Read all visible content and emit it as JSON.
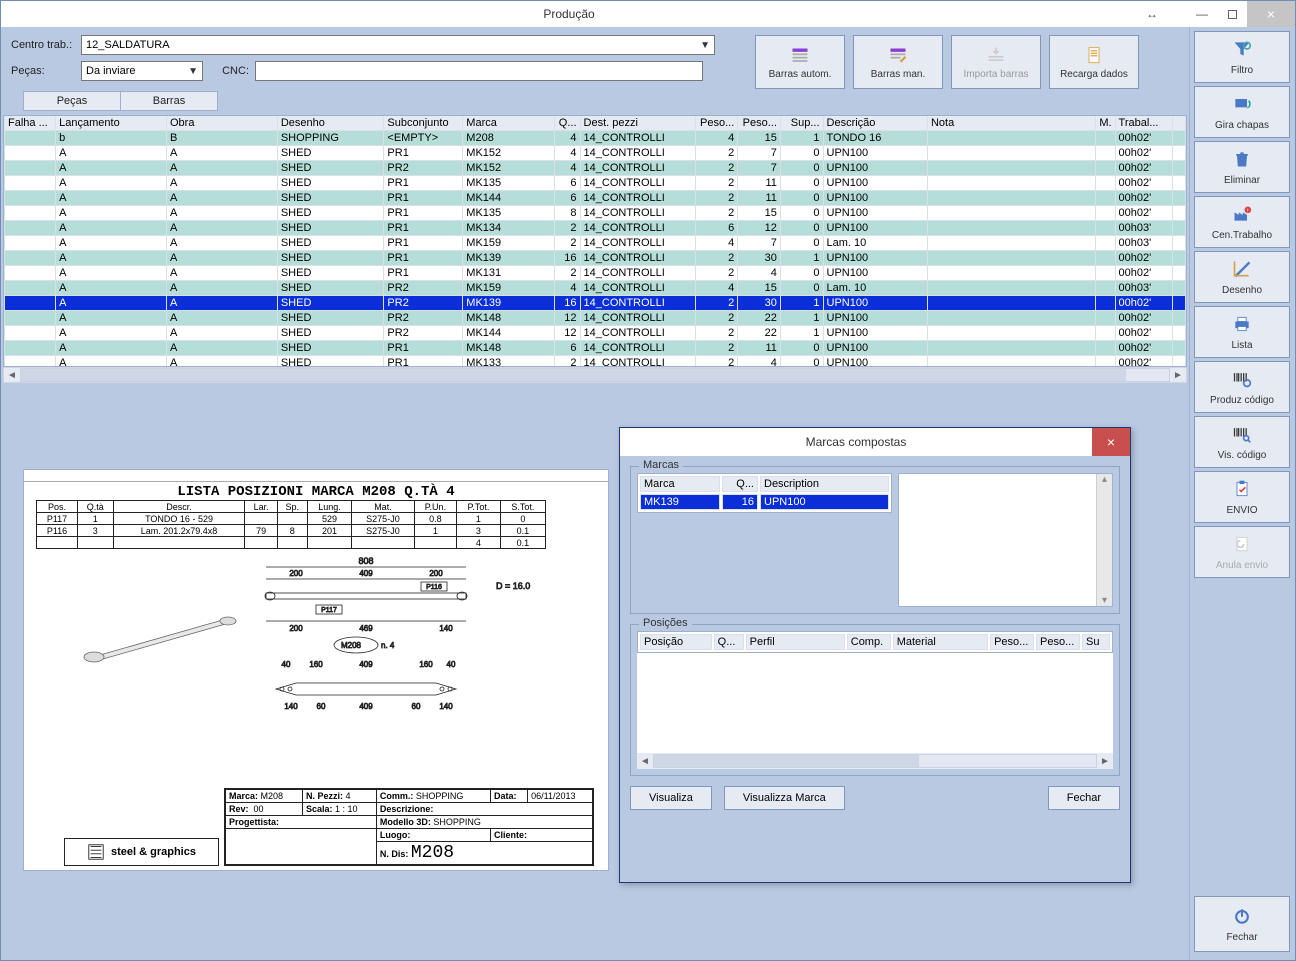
{
  "window": {
    "title": "Produção"
  },
  "form": {
    "centro_label": "Centro trab.:",
    "centro_value": "12_SALDATURA",
    "pecas_label": "Peças:",
    "pecas_value": "Da inviare",
    "cnc_label": "CNC:"
  },
  "toolbar": {
    "barras_autom": "Barras autom.",
    "barras_man": "Barras man.",
    "importa_barras": "Importa barras",
    "recarga_dados": "Recarga dados",
    "filtro": "Filtro"
  },
  "tabs": {
    "pecas": "Peças",
    "barras": "Barras"
  },
  "grid": {
    "headers": [
      "Falha ...",
      "Lançamento",
      "Obra",
      "Desenho",
      "Subconjunto",
      "Marca",
      "Q...",
      "Dest. pezzi",
      "Peso...",
      "Peso...",
      "Sup...",
      "Descrição",
      "Nota",
      "M.",
      "Trabal...",
      ""
    ],
    "rows": [
      {
        "c": [
          "",
          "b",
          "B",
          "SHOPPING",
          "<EMPTY>",
          "M208",
          "4",
          "14_CONTROLLI",
          "4",
          "15",
          "1",
          "TONDO 16",
          "",
          "",
          "00h02'",
          ""
        ]
      },
      {
        "c": [
          "",
          "A",
          "A",
          "SHED",
          "PR1",
          "MK152",
          "4",
          "14_CONTROLLI",
          "2",
          "7",
          "0",
          "UPN100",
          "",
          "",
          "00h02'",
          ""
        ]
      },
      {
        "c": [
          "",
          "A",
          "A",
          "SHED",
          "PR2",
          "MK152",
          "4",
          "14_CONTROLLI",
          "2",
          "7",
          "0",
          "UPN100",
          "",
          "",
          "00h02'",
          ""
        ]
      },
      {
        "c": [
          "",
          "A",
          "A",
          "SHED",
          "PR1",
          "MK135",
          "6",
          "14_CONTROLLI",
          "2",
          "11",
          "0",
          "UPN100",
          "",
          "",
          "00h02'",
          ""
        ]
      },
      {
        "c": [
          "",
          "A",
          "A",
          "SHED",
          "PR1",
          "MK144",
          "6",
          "14_CONTROLLI",
          "2",
          "11",
          "0",
          "UPN100",
          "",
          "",
          "00h02'",
          ""
        ]
      },
      {
        "c": [
          "",
          "A",
          "A",
          "SHED",
          "PR1",
          "MK135",
          "8",
          "14_CONTROLLI",
          "2",
          "15",
          "0",
          "UPN100",
          "",
          "",
          "00h02'",
          ""
        ]
      },
      {
        "c": [
          "",
          "A",
          "A",
          "SHED",
          "PR1",
          "MK134",
          "2",
          "14_CONTROLLI",
          "6",
          "12",
          "0",
          "UPN100",
          "",
          "",
          "00h03'",
          ""
        ]
      },
      {
        "c": [
          "",
          "A",
          "A",
          "SHED",
          "PR1",
          "MK159",
          "2",
          "14_CONTROLLI",
          "4",
          "7",
          "0",
          "Lam. 10",
          "",
          "",
          "00h03'",
          ""
        ]
      },
      {
        "c": [
          "",
          "A",
          "A",
          "SHED",
          "PR1",
          "MK139",
          "16",
          "14_CONTROLLI",
          "2",
          "30",
          "1",
          "UPN100",
          "",
          "",
          "00h02'",
          ""
        ]
      },
      {
        "c": [
          "",
          "A",
          "A",
          "SHED",
          "PR1",
          "MK131",
          "2",
          "14_CONTROLLI",
          "2",
          "4",
          "0",
          "UPN100",
          "",
          "",
          "00h02'",
          ""
        ]
      },
      {
        "c": [
          "",
          "A",
          "A",
          "SHED",
          "PR2",
          "MK159",
          "4",
          "14_CONTROLLI",
          "4",
          "15",
          "0",
          "Lam. 10",
          "",
          "",
          "00h03'",
          ""
        ]
      },
      {
        "c": [
          "",
          "A",
          "A",
          "SHED",
          "PR2",
          "MK139",
          "16",
          "14_CONTROLLI",
          "2",
          "30",
          "1",
          "UPN100",
          "",
          "",
          "00h02'",
          ""
        ],
        "sel": true
      },
      {
        "c": [
          "",
          "A",
          "A",
          "SHED",
          "PR2",
          "MK148",
          "12",
          "14_CONTROLLI",
          "2",
          "22",
          "1",
          "UPN100",
          "",
          "",
          "00h02'",
          ""
        ]
      },
      {
        "c": [
          "",
          "A",
          "A",
          "SHED",
          "PR2",
          "MK144",
          "12",
          "14_CONTROLLI",
          "2",
          "22",
          "1",
          "UPN100",
          "",
          "",
          "00h02'",
          ""
        ]
      },
      {
        "c": [
          "",
          "A",
          "A",
          "SHED",
          "PR1",
          "MK148",
          "6",
          "14_CONTROLLI",
          "2",
          "11",
          "0",
          "UPN100",
          "",
          "",
          "00h02'",
          ""
        ]
      },
      {
        "c": [
          "",
          "A",
          "A",
          "SHED",
          "PR1",
          "MK133",
          "2",
          "14_CONTROLLI",
          "2",
          "4",
          "0",
          "UPN100",
          "",
          "",
          "00h02'",
          ""
        ]
      }
    ]
  },
  "drawing": {
    "title": "LISTA POSIZIONI MARCA M208 Q.TÀ 4",
    "headers": [
      "Pos.",
      "Q.tà",
      "Descr.",
      "Lar.",
      "Sp.",
      "Lung.",
      "Mat.",
      "P.Un.",
      "P.Tot.",
      "S.Tot."
    ],
    "rows": [
      [
        "P117",
        "1",
        "TONDO 16 - 529",
        "",
        "",
        "529",
        "S275-J0",
        "0.8",
        "1",
        "0"
      ],
      [
        "P116",
        "3",
        "Lam. 201.2x79.4x8",
        "79",
        "8",
        "201",
        "S275-J0",
        "1",
        "3",
        "0.1"
      ],
      [
        "",
        "",
        "",
        "",
        "",
        "",
        "",
        "",
        "4",
        "0.1"
      ]
    ],
    "dims": {
      "overall": "808",
      "seg1": "200",
      "seg2": "409",
      "seg3": "200",
      "d": "D = 16.0",
      "inner": "469",
      "tail": "140",
      "label117": "P117",
      "label116": "P116",
      "mark": "M208",
      "qty": "n. 4",
      "b1": "40",
      "b2": "160",
      "b3": "60",
      "b4": "140"
    },
    "titleblock": {
      "marca_l": "Marca:",
      "marca_v": "M208",
      "npezzi_l": "N. Pezzi:",
      "npezzi_v": "4",
      "comm_l": "Comm.:",
      "comm_v": "SHOPPING",
      "data_l": "Data:",
      "data_v": "06/11/2013",
      "rev_l": "Rev:",
      "rev_v": "00",
      "scala_l": "Scala:",
      "scala_v": "1 : 10",
      "descr_l": "Descrizione:",
      "prog_l": "Progettista:",
      "model_l": "Modello 3D:",
      "model_v": "SHOPPING",
      "luogo_l": "Luogo:",
      "cliente_l": "Cliente:",
      "ndis_l": "N. Dis:",
      "ndis_v": "M208",
      "logo": "steel & graphics"
    }
  },
  "dialog": {
    "title": "Marcas compostas",
    "marcas_legend": "Marcas",
    "marcas_headers": [
      "Marca",
      "Q...",
      "Description"
    ],
    "marcas_rows": [
      {
        "c": [
          "MK139",
          "16",
          "UPN100"
        ],
        "sel": true
      }
    ],
    "posicoes_legend": "Posições",
    "pos_headers": [
      "Posição",
      "Q...",
      "Perfil",
      "Comp.",
      "Material",
      "Peso...",
      "Peso...",
      "Su"
    ],
    "btn_visualiza": "Visualiza",
    "btn_visualiza_marca": "Visualizza Marca",
    "btn_fechar": "Fechar"
  },
  "sidebar": {
    "filtro": "Filtro",
    "gira": "Gira chapas",
    "eliminar": "Eliminar",
    "centrab": "Cen.Trabalho",
    "desenho": "Desenho",
    "lista": "Lista",
    "produz": "Produz código",
    "viscod": "Vis. código",
    "envio": "ENVIO",
    "anula": "Anula envio",
    "fechar": "Fechar"
  }
}
